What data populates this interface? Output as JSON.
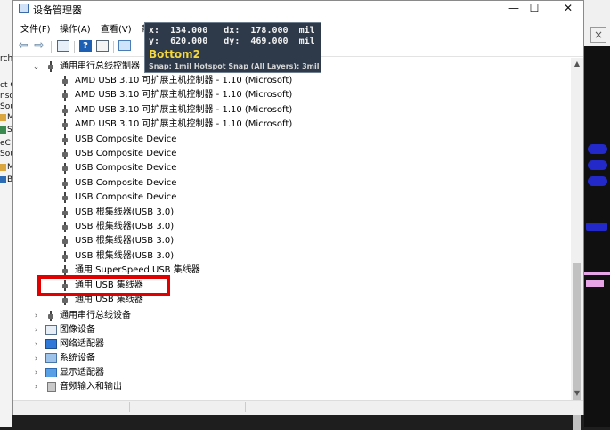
{
  "window": {
    "title": "设备管理器",
    "minimize_glyph": "—",
    "maximize_glyph": "☐",
    "close_glyph": "✕"
  },
  "menu": [
    {
      "label": "文件(F)"
    },
    {
      "label": "操作(A)"
    },
    {
      "label": "查看(V)"
    },
    {
      "label": "帮助"
    }
  ],
  "toolbar": {
    "back_glyph": "⇦",
    "forward_glyph": "⇨",
    "help_glyph": "?"
  },
  "tooltip": {
    "x_line": "x:  134.000   dx:  178.000  mil",
    "y_line": "y:  620.000   dy:  469.000  mil",
    "layer": "Bottom2",
    "snap": "Snap: 1mil Hotspot Snap (All Layers): 3mil"
  },
  "tree": {
    "expanded_category": {
      "label": "通用串行总线控制器",
      "icon": "usb-icon",
      "expanded": true
    },
    "children": [
      {
        "label": "AMD USB 3.10 可扩展主机控制器 - 1.10 (Microsoft)"
      },
      {
        "label": "AMD USB 3.10 可扩展主机控制器 - 1.10 (Microsoft)"
      },
      {
        "label": "AMD USB 3.10 可扩展主机控制器 - 1.10 (Microsoft)"
      },
      {
        "label": "AMD USB 3.10 可扩展主机控制器 - 1.10 (Microsoft)"
      },
      {
        "label": "USB Composite Device"
      },
      {
        "label": "USB Composite Device"
      },
      {
        "label": "USB Composite Device"
      },
      {
        "label": "USB Composite Device"
      },
      {
        "label": "USB Composite Device"
      },
      {
        "label": "USB 根集线器(USB 3.0)"
      },
      {
        "label": "USB 根集线器(USB 3.0)"
      },
      {
        "label": "USB 根集线器(USB 3.0)"
      },
      {
        "label": "USB 根集线器(USB 3.0)"
      },
      {
        "label": "通用 SuperSpeed USB 集线器"
      },
      {
        "label": "通用 USB 集线器"
      },
      {
        "label": "通用 USB 集线器"
      }
    ],
    "collapsed_categories": [
      {
        "label": "通用串行总线设备",
        "icon": "usb-icon"
      },
      {
        "label": "图像设备",
        "icon": "camera-icon"
      },
      {
        "label": "网络适配器",
        "icon": "network-adapter-icon"
      },
      {
        "label": "系统设备",
        "icon": "system-device-icon"
      },
      {
        "label": "显示适配器",
        "icon": "display-adapter-icon"
      },
      {
        "label": "音频输入和输出",
        "icon": "speaker-icon"
      }
    ],
    "expand_glyph": "›",
    "expanded_glyph": "⌄"
  },
  "annotation": {
    "color": "#e00000"
  },
  "background": {
    "left_fragments": [
      "rch",
      "ct G",
      "nso",
      "Sou",
      "M",
      "S",
      "eC",
      "Sou",
      "M",
      "B"
    ],
    "close_glyph": "×"
  }
}
